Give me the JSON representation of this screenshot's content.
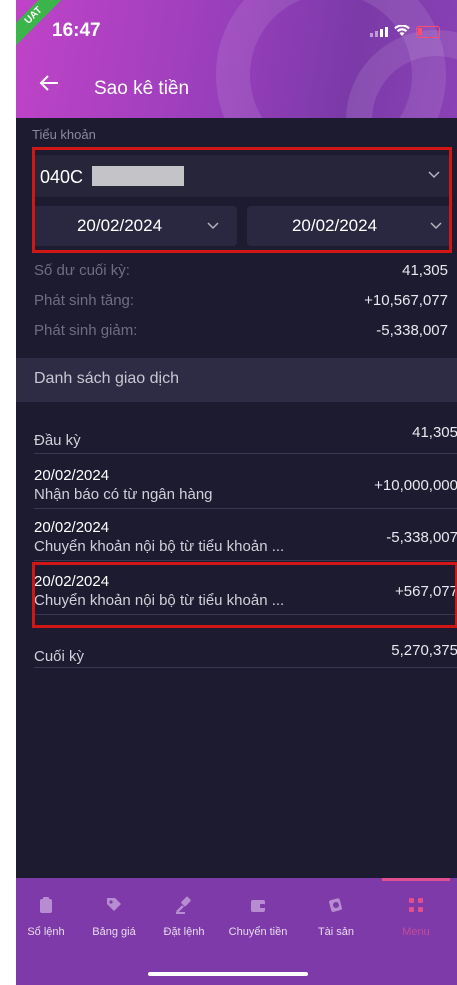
{
  "status": {
    "time": "16:47",
    "badge": "UAT"
  },
  "header": {
    "title": "Sao kê tiền"
  },
  "filter": {
    "account_label": "Tiểu khoản",
    "account_value": "040C",
    "date_from": "20/02/2024",
    "date_to": "20/02/2024"
  },
  "summary": {
    "closing_label": "Số dư cuối kỳ:",
    "closing_value": "41,305",
    "increase_label": "Phát sinh tăng:",
    "increase_value": "+10,567,077",
    "decrease_label": "Phát sinh giảm:",
    "decrease_value": "-5,338,007"
  },
  "list": {
    "title": "Danh sách giao dịch",
    "opening_label": "Đầu kỳ",
    "opening_value": "41,305",
    "transactions": [
      {
        "date": "20/02/2024",
        "description": "Nhận báo có từ ngân hàng",
        "amount": "+10,000,000"
      },
      {
        "date": "20/02/2024",
        "description": "Chuyển khoản nội bộ từ tiểu khoản ...",
        "amount": "-5,338,007"
      },
      {
        "date": "20/02/2024",
        "description": "Chuyển khoản nội bộ từ tiểu khoản ...",
        "amount": "+567,077"
      }
    ],
    "closing_label": "Cuối kỳ",
    "closing_value": "5,270,375"
  },
  "nav": {
    "items": [
      {
        "label": "Sổ lệnh",
        "icon": "clipboard-icon"
      },
      {
        "label": "Bảng giá",
        "icon": "tag-icon"
      },
      {
        "label": "Đặt lệnh",
        "icon": "gavel-icon"
      },
      {
        "label": "Chuyển tiền",
        "icon": "wallet-icon"
      },
      {
        "label": "Tài sản",
        "icon": "coins-icon"
      },
      {
        "label": "Menu",
        "icon": "grid-icon"
      }
    ],
    "active": "Menu"
  },
  "colors": {
    "accent": "#e0508e",
    "background": "#1d1b30",
    "nav_background": "#7d3aa8",
    "highlight_box": "#d11616"
  }
}
